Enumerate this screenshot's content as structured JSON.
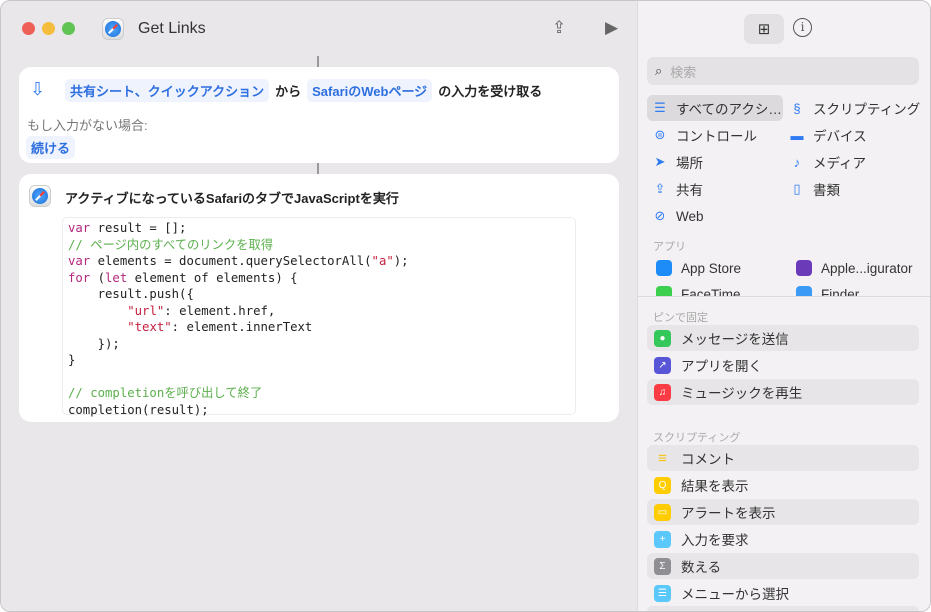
{
  "window": {
    "title": "Get Links"
  },
  "input_action": {
    "source_chip": "共有シート、クイックアクション",
    "from": "から",
    "type_chip": "SafariのWebページ",
    "suffix": "の入力を受け取る",
    "no_input_label": "もし入力がない場合:",
    "no_input_value": "続ける"
  },
  "js_action": {
    "title": "アクティブになっているSafariのタブでJavaScriptを実行",
    "code": [
      [
        [
          "kw",
          "var"
        ],
        [
          "",
          "result = [];"
        ]
      ],
      [
        [
          "cm",
          "// ページ内のすべてのリンクを取得"
        ]
      ],
      [
        [
          "kw",
          "var"
        ],
        [
          "",
          " elements = document.querySelectorAll("
        ],
        [
          "str",
          "\"a\""
        ],
        [
          "",
          ");"
        ]
      ],
      [
        [
          "kw",
          "for"
        ],
        [
          "",
          " ("
        ],
        [
          "kw",
          "let"
        ],
        [
          "",
          " element of elements) {"
        ]
      ],
      [
        [
          "",
          "    result.push({"
        ]
      ],
      [
        [
          "",
          "        "
        ],
        [
          "str",
          "\"url\""
        ],
        [
          "",
          ": element.href,"
        ]
      ],
      [
        [
          "",
          "        "
        ],
        [
          "str",
          "\"text\""
        ],
        [
          "",
          ": element.innerText"
        ]
      ],
      [
        [
          "",
          "    });"
        ]
      ],
      [
        [
          "",
          "}"
        ]
      ],
      [
        [
          "",
          ""
        ]
      ],
      [
        [
          "cm",
          "// completionを呼び出して終了"
        ]
      ],
      [
        [
          "",
          "completion(result);"
        ]
      ]
    ]
  },
  "sidebar": {
    "search_placeholder": "検索",
    "categories": [
      {
        "label": "すべてのアクシ…",
        "icon": "list-icon"
      },
      {
        "label": "スクリプティング",
        "icon": "scripting-icon"
      },
      {
        "label": "コントロール",
        "icon": "toggle-icon"
      },
      {
        "label": "デバイス",
        "icon": "display-icon"
      },
      {
        "label": "場所",
        "icon": "location-icon"
      },
      {
        "label": "メディア",
        "icon": "music-note-icon"
      },
      {
        "label": "共有",
        "icon": "share-icon"
      },
      {
        "label": "書類",
        "icon": "document-icon"
      },
      {
        "label": "Web",
        "icon": "compass-icon"
      }
    ],
    "apps_header": "アプリ",
    "apps": [
      {
        "label": "App Store",
        "color": "#1d8cf8"
      },
      {
        "label": "Apple...igurator",
        "color": "#6a3ab8"
      },
      {
        "label": "FaceTime",
        "color": "#3ccf4e"
      },
      {
        "label": "Finder",
        "color": "#3a9af5"
      }
    ],
    "pinned_header": "ピンで固定",
    "pinned": [
      {
        "label": "メッセージを送信",
        "color": "#34c759",
        "glyph": "●"
      },
      {
        "label": "アプリを開く",
        "color": "#5856d6",
        "glyph": "↗"
      },
      {
        "label": "ミュージックを再生",
        "color": "#fc3c44",
        "glyph": "♫"
      }
    ],
    "scripting_header": "スクリプティング",
    "scripting": [
      {
        "label": "コメント",
        "color": "",
        "glyph": "≡"
      },
      {
        "label": "結果を表示",
        "color": "#ffcc00",
        "glyph": "Q"
      },
      {
        "label": "アラートを表示",
        "color": "#ffcc00",
        "glyph": "▭"
      },
      {
        "label": "入力を要求",
        "color": "#5ac8fa",
        "glyph": "+"
      },
      {
        "label": "数える",
        "color": "#8e8e93",
        "glyph": "Σ"
      },
      {
        "label": "メニューから選択",
        "color": "#5ac8fa",
        "glyph": "☰"
      }
    ]
  }
}
